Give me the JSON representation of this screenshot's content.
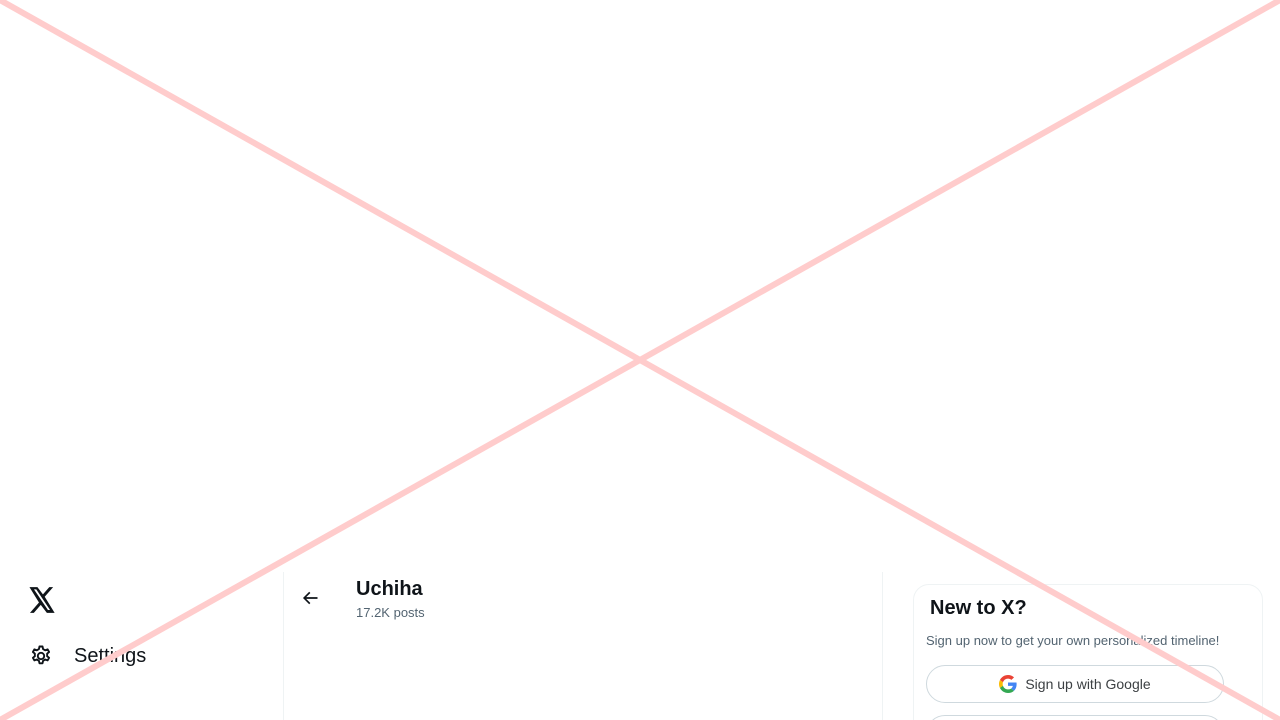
{
  "sidebar": {
    "logo_icon": "x-logo-icon",
    "items": [
      {
        "label": "Settings",
        "icon": "gear-icon"
      }
    ]
  },
  "main": {
    "back_icon": "arrow-left-icon",
    "profile_name": "Uchiha",
    "post_count": "17.2K posts"
  },
  "signup_card": {
    "title": "New to X?",
    "subtitle": "Sign up now to get your own personalized timeline!",
    "google_button_label": "Sign up with Google",
    "google_icon": "google-g-icon"
  },
  "colors": {
    "text_primary": "#0f1419",
    "text_secondary": "#536471",
    "border": "#eff3f4",
    "overlay_x": "#ffcccc"
  }
}
